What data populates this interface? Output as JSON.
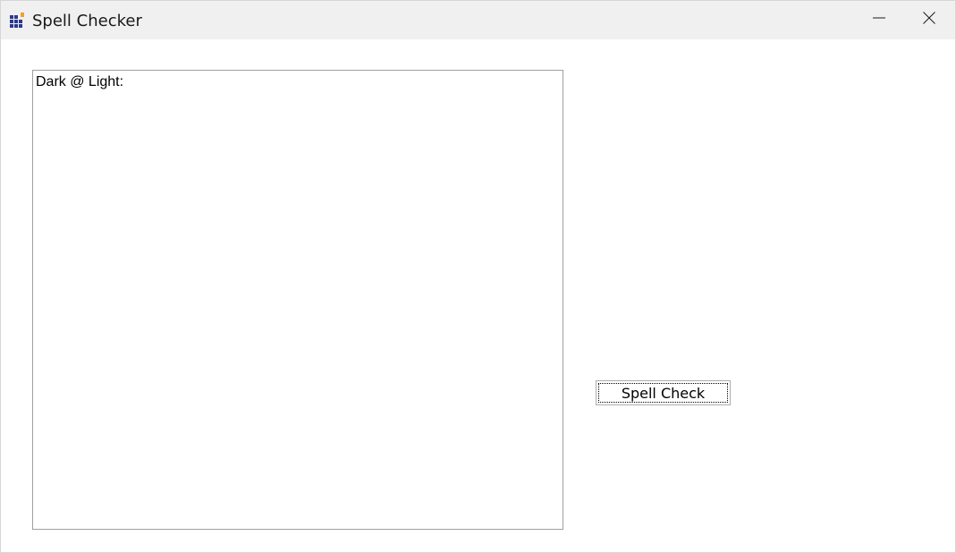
{
  "window": {
    "title": "Spell Checker",
    "icon": "app-grid-icon",
    "controls": {
      "minimize_icon": "minimize-icon",
      "close_icon": "close-icon"
    }
  },
  "main": {
    "text_area_value": "Dark @ Light:",
    "spell_check_label": "Spell Check"
  },
  "colors": {
    "titlebar_bg": "#f0f0f0",
    "icon_blue": "#2b3a8c",
    "icon_orange": "#f0a030"
  }
}
